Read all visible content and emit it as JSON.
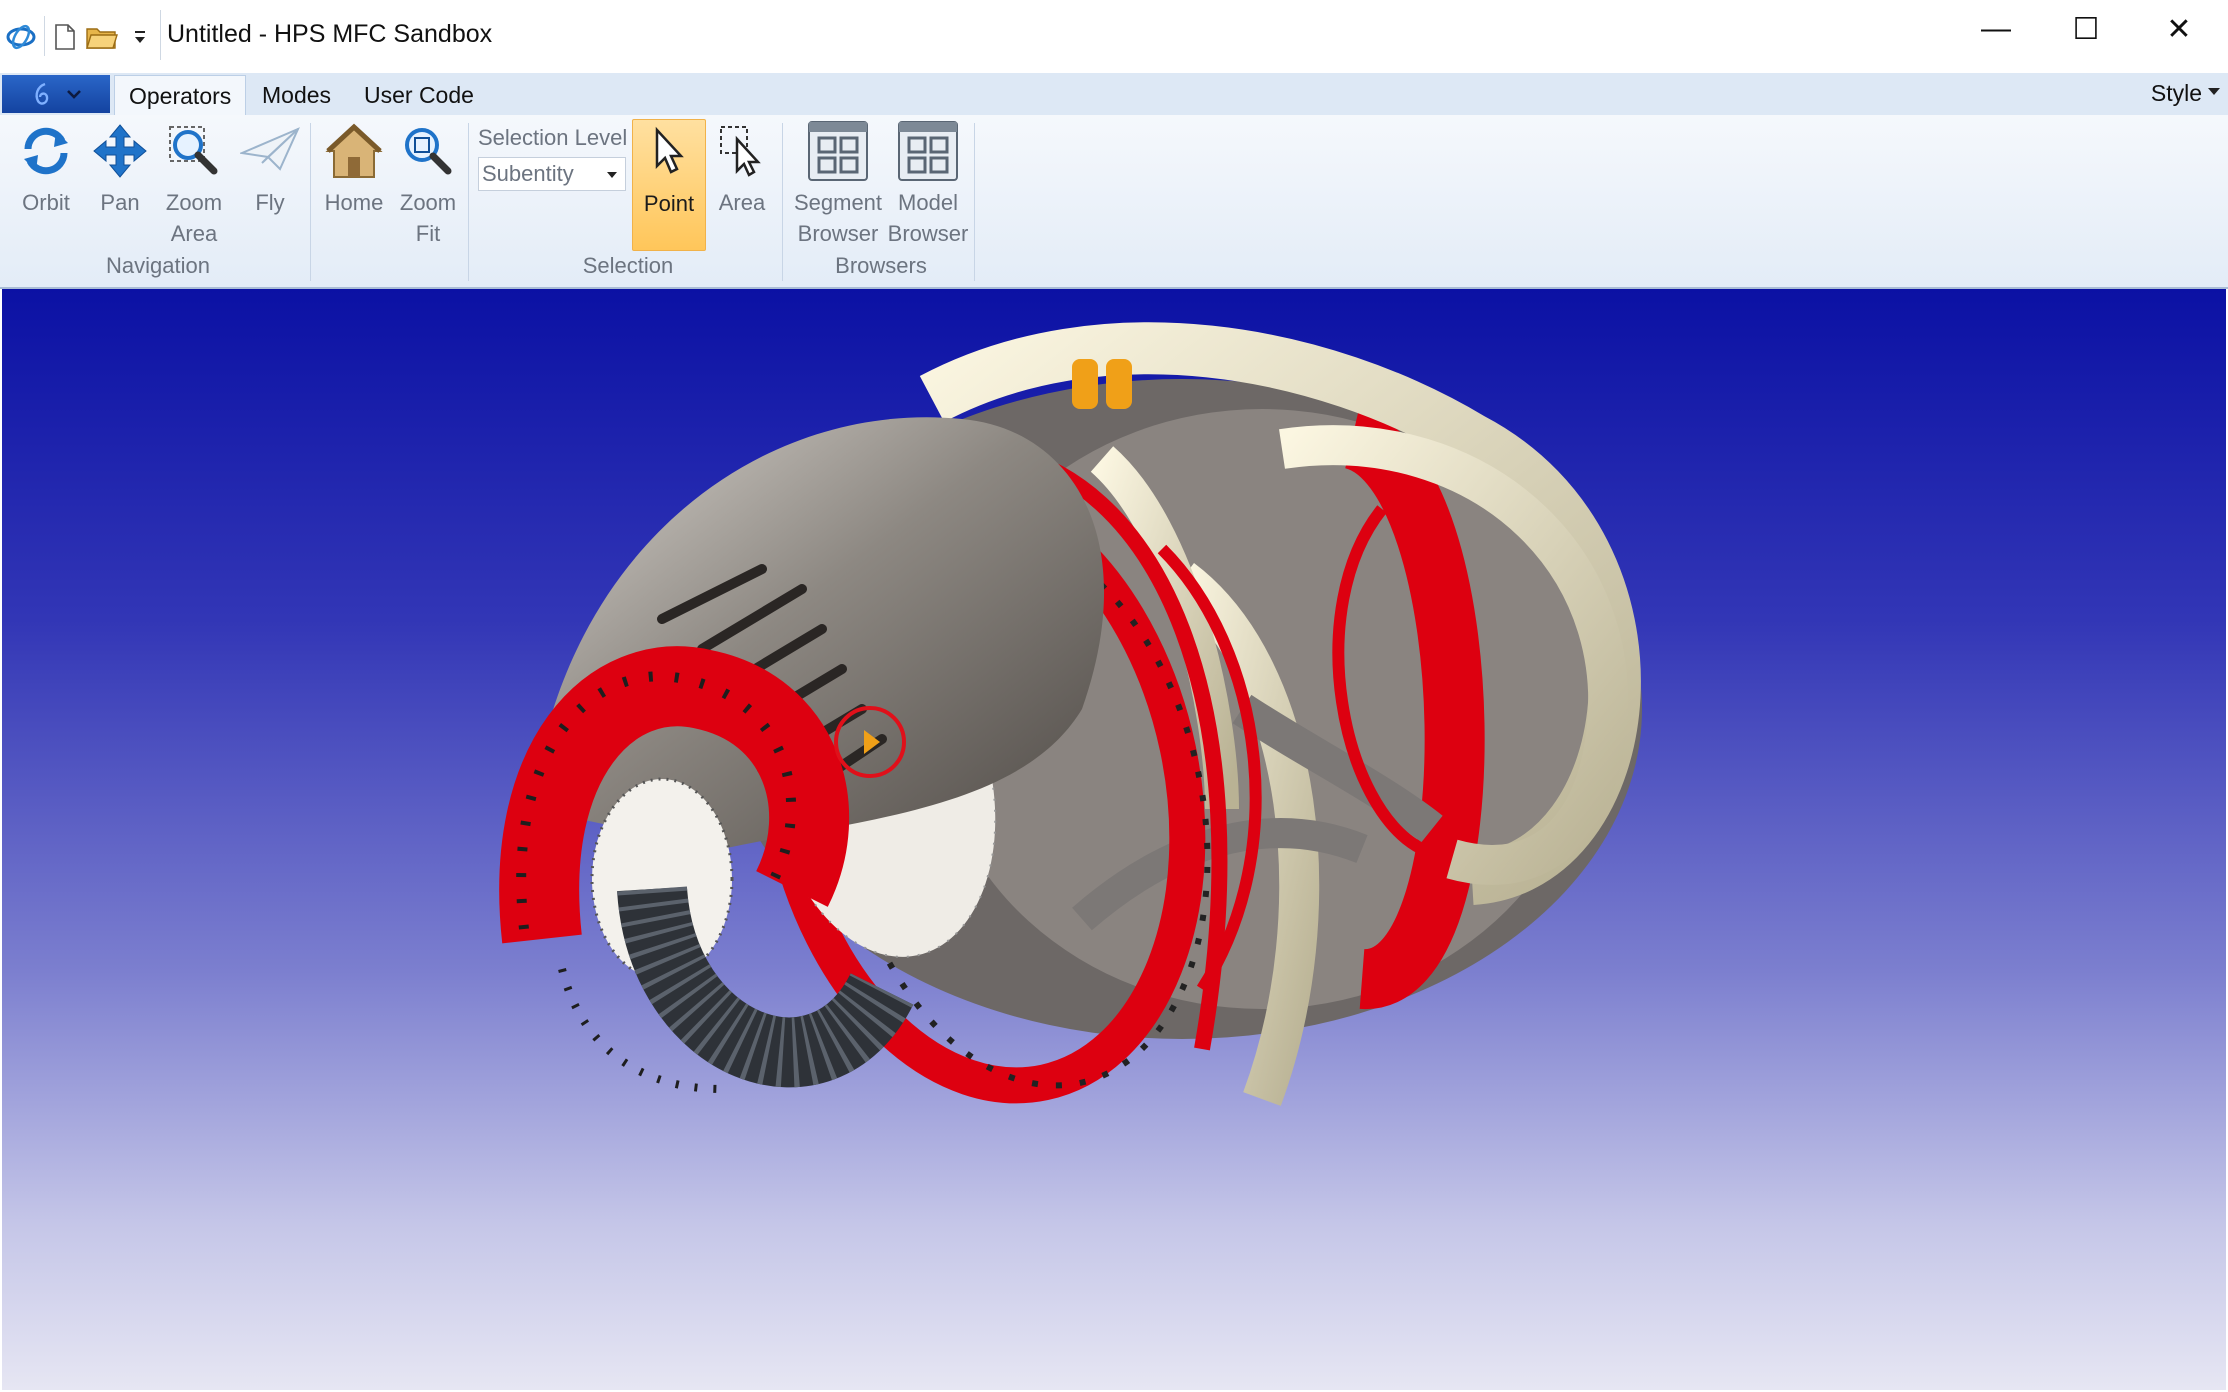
{
  "window": {
    "title": "Untitled - HPS MFC Sandbox",
    "controls": {
      "minimize": "—",
      "maximize": "☐",
      "close": "✕"
    }
  },
  "ribbon_tabs": [
    "Operators",
    "Modes",
    "User Code"
  ],
  "style_menu": "Style",
  "groups": {
    "navigation": {
      "label": "Navigation",
      "buttons": {
        "orbit": "Orbit",
        "pan": "Pan",
        "zoom_area_1": "Zoom",
        "zoom_area_2": "Area",
        "fly": "Fly"
      }
    },
    "view": {
      "buttons": {
        "home": "Home",
        "zoom_fit_1": "Zoom",
        "zoom_fit_2": "Fit"
      }
    },
    "selection": {
      "label": "Selection",
      "level_label": "Selection Level",
      "level_value": "Subentity",
      "buttons": {
        "point": "Point",
        "area": "Area"
      },
      "active": "Point"
    },
    "browsers": {
      "label": "Browsers",
      "buttons": {
        "segment_1": "Segment",
        "segment_2": "Browser",
        "model_1": "Model",
        "model_2": "Browser"
      }
    }
  },
  "colors": {
    "viewport_top": "#0b11a4",
    "viewport_bottom": "#e6e6f3",
    "selected_button": "#ffc65a",
    "model_accent": "#e00010"
  }
}
